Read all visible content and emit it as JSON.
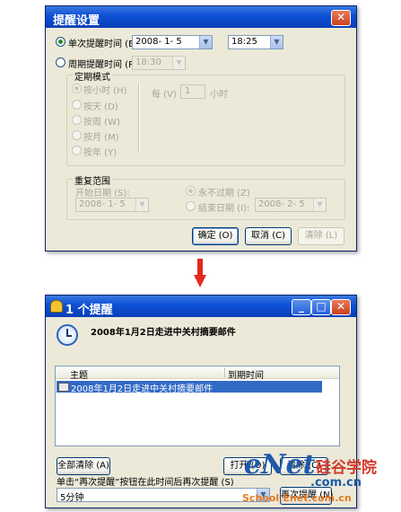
{
  "top_dialog": {
    "title": "提醒设置",
    "single_label": "单次提醒时间 (E)",
    "single_date": "2008- 1- 5",
    "single_time": "18:25",
    "periodic_label": "周期提醒时间 (P)",
    "periodic_time": "18:30",
    "mode_group": "定期模式",
    "mode_options": [
      "按小时 (H)",
      "按天 (D)",
      "按周 (W)",
      "按月 (M)",
      "按年 (Y)"
    ],
    "every_label": "每 (V)",
    "every_value": "1",
    "every_unit": "小时",
    "range_group": "重复范围",
    "start_label": "开始日期 (S):",
    "start_date": "2008- 1- 5",
    "never_label": "永不过期 (Z)",
    "end_label": "结束日期 (I):",
    "end_date": "2008- 2- 5",
    "ok": "确定 (O)",
    "cancel": "取消 (C)",
    "clear": "清除 (L)"
  },
  "bottom_dialog": {
    "title": "1 个提醒",
    "headline": "2008年1月2日走进中关村摘要邮件",
    "col_subject": "主题",
    "col_due": "到期时间",
    "row_subject": "2008年1月2日走进中关村摘要邮件",
    "clear_all": "全部清除 (A)",
    "open": "打开 (O)",
    "clear": "清除 (C)",
    "snooze_hint": "单击“再次提醒”按钮在此时间后再次提醒 (S)",
    "snooze_value": "5分钟",
    "snooze_btn": "再次提醒 (N)"
  },
  "watermark": {
    "brand": "eNet",
    "domain": ".com.cn",
    "cn": "硅谷学院",
    "school": "School.Enet.com.cn"
  }
}
